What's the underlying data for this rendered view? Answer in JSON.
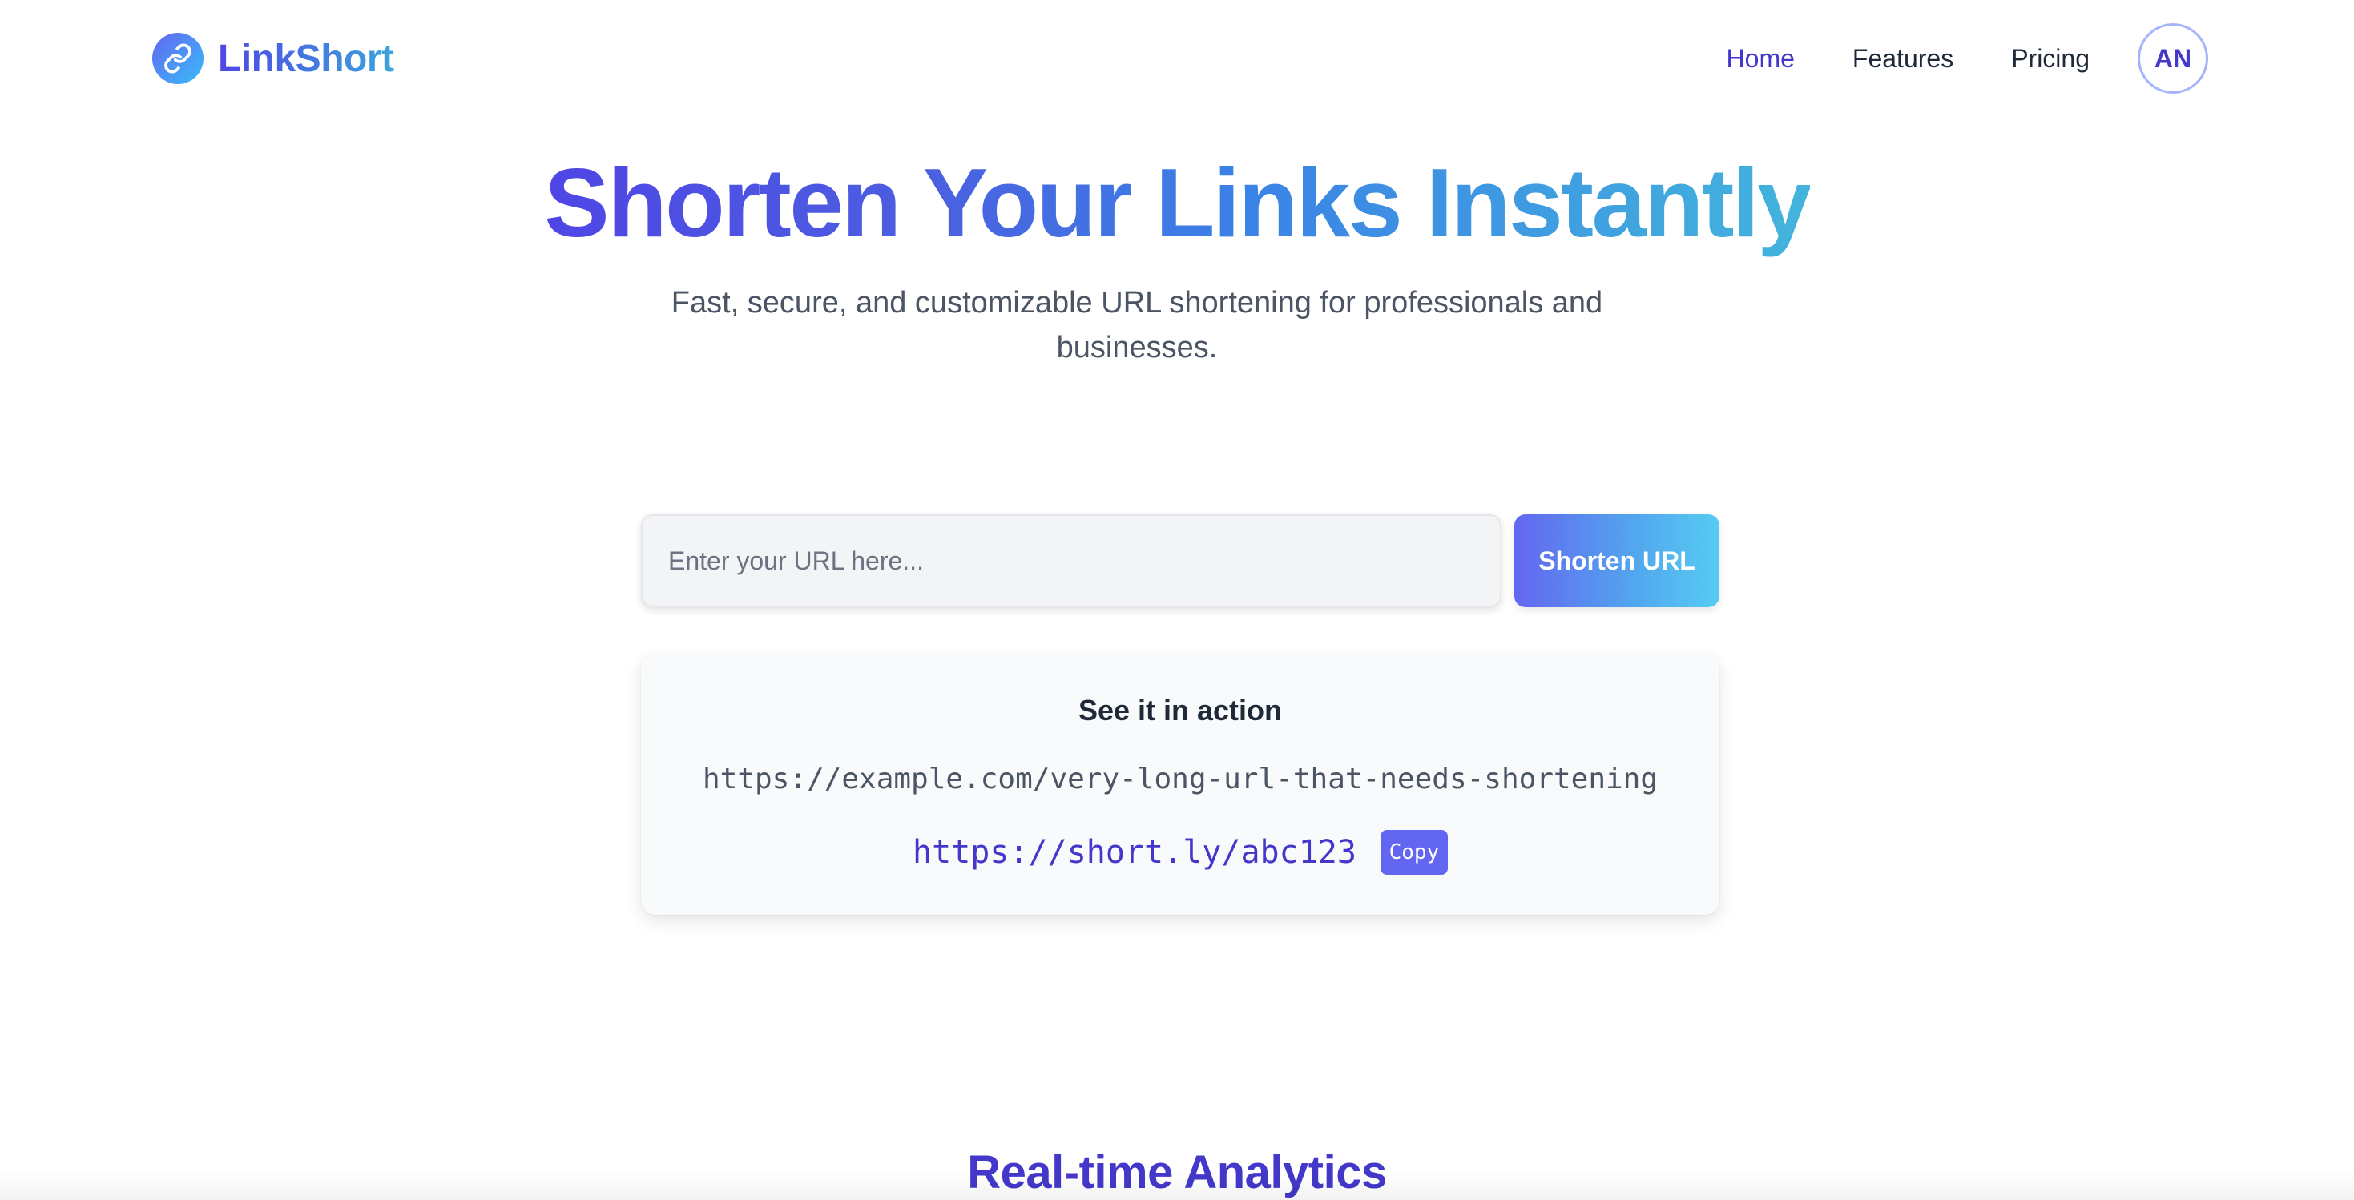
{
  "brand": {
    "name": "LinkShort",
    "icon": "link-icon",
    "colors": {
      "primary": "#4f46e5",
      "accent": "#38bdf8"
    }
  },
  "nav": {
    "items": [
      {
        "label": "Home",
        "active": true
      },
      {
        "label": "Features",
        "active": false
      },
      {
        "label": "Pricing",
        "active": false
      }
    ],
    "avatar_initials": "AN"
  },
  "hero": {
    "title": "Shorten Your Links Instantly",
    "subtitle": "Fast, secure, and customizable URL shortening for professionals and businesses."
  },
  "shortener": {
    "input_placeholder": "Enter your URL here...",
    "input_value": "",
    "button_label": "Shorten URL"
  },
  "demo": {
    "title": "See it in action",
    "long_url": "https://example.com/very-long-url-that-needs-shortening",
    "short_url": "https://short.ly/abc123",
    "copy_label": "Copy"
  },
  "next_section": {
    "title": "Real-time Analytics"
  }
}
